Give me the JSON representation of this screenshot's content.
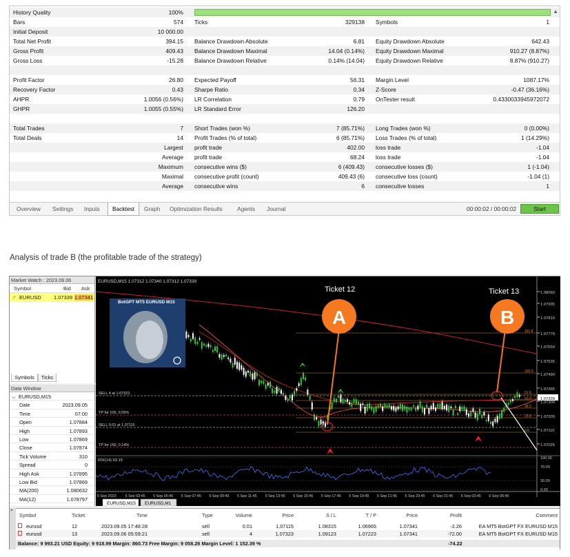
{
  "report": {
    "rows": [
      {
        "cells": [
          "History Quality",
          "100%"
        ]
      },
      {
        "cells": [
          "Bars",
          "574",
          "Ticks",
          "329138",
          "Symbols",
          "1"
        ]
      },
      {
        "cells": [
          "Initial Deposit",
          "10 000.00"
        ]
      },
      {
        "cells": [
          "Total Net Profit",
          "394.15",
          "Balance Drawdown Absolute",
          "6.81",
          "Equity Drawdown Absolute",
          "642.43"
        ]
      },
      {
        "cells": [
          "Gross Profit",
          "409.43",
          "Balance Drawdown Maximal",
          "14.04 (0.14%)",
          "Equity Drawdown Maximal",
          "910.27 (8.87%)"
        ]
      },
      {
        "cells": [
          "Gross Loss",
          "-15.28",
          "Balance Drawdown Relative",
          "0.14% (14.04)",
          "Equity Drawdown Relative",
          "8.87% (910.27)"
        ]
      },
      {
        "cells": []
      },
      {
        "cells": [
          "Profit Factor",
          "26.80",
          "Expected Payoff",
          "56.31",
          "Margin Level",
          "1087.17%"
        ]
      },
      {
        "cells": [
          "Recovery Factor",
          "0.43",
          "Sharpe Ratio",
          "0.34",
          "Z-Score",
          "-0.47 (36.16%)"
        ]
      },
      {
        "cells": [
          "AHPR",
          "1.0056 (0.56%)",
          "LR Correlation",
          "0.79",
          "OnTester result",
          "0.433003394597207​2"
        ]
      },
      {
        "cells": [
          "GHPR",
          "1.0055 (0.55%)",
          "LR Standard Error",
          "126.20"
        ]
      },
      {
        "cells": []
      },
      {
        "cells": [
          "Total Trades",
          "7",
          "Short Trades (won %)",
          "7 (85.71%)",
          "Long Trades (won %)",
          "0 (0.00%)"
        ]
      },
      {
        "cells": [
          "Total Deals",
          "14",
          "Profit Trades (% of total)",
          "6 (85.71%)",
          "Loss Trades (% of total)",
          "1 (14.29%)"
        ]
      },
      {
        "cells": [
          "",
          "Largest",
          "profit trade",
          "402.00",
          "loss trade",
          "-1.04"
        ]
      },
      {
        "cells": [
          "",
          "Average",
          "profit trade",
          "68.24",
          "loss trade",
          "-1.04"
        ]
      },
      {
        "cells": [
          "",
          "Maximum",
          "consecutive wins ($)",
          "6 (409.43)",
          "consecutive losses ($)",
          "1 (-1.04)"
        ]
      },
      {
        "cells": [
          "",
          "Maximal",
          "consecutive profit (count)",
          "409.43 (6)",
          "consecutive loss (count)",
          "-1.04 (1)"
        ]
      },
      {
        "cells": [
          "",
          "Average",
          "consecutive wins",
          "6",
          "consecutive losses",
          "1"
        ]
      }
    ],
    "history_quality_percent": 100,
    "tabs": [
      "Overview",
      "Settings",
      "Inputs",
      "Backtest",
      "Graph",
      "Optimization Results",
      "Agents",
      "Journal"
    ],
    "active_tab": "Backtest",
    "timer": "00:00:02 / 00:00:02",
    "start_label": "Start",
    "bar_color": "#9ce17d",
    "start_color": "#6cc24a"
  },
  "caption": "Analysis of trade B (the profitable trade of the strategy)",
  "market_watch": {
    "title": "Market Watch : 2023.09.06",
    "headers": [
      "Symbol",
      "Bid",
      "Ask"
    ],
    "symbol": "EURUSD",
    "bid": "1.07339",
    "ask": "1.07341",
    "tabs": [
      "Symbols",
      "Ticks"
    ]
  },
  "data_window": {
    "title": "Data Window",
    "symbol": "EURUSD,M15",
    "rows": [
      {
        "label": "Date",
        "value": "2023.09.05"
      },
      {
        "label": "Time",
        "value": "07:00"
      },
      {
        "label": "Open",
        "value": "1.07884"
      },
      {
        "label": "High",
        "value": "1.07893"
      },
      {
        "label": "Low",
        "value": "1.07869"
      },
      {
        "label": "Close",
        "value": "1.07874"
      },
      {
        "label": "Tick Volume",
        "value": "310"
      },
      {
        "label": "Spread",
        "value": "0"
      },
      {
        "label": "High Ask",
        "value": "1.07895"
      },
      {
        "label": "Low Bid",
        "value": "1.07869"
      },
      {
        "label": "MA(200)",
        "value": "1.080632"
      },
      {
        "label": "MA(12)",
        "value": "1.078797"
      }
    ]
  },
  "chart": {
    "header": "EURUSD,M15  1.07312 1.07340 1.07312 1.07339",
    "logo_title": "BotGPT MT5 EURUSD M15",
    "ticket_a_label": "Ticket 12",
    "ticket_b_label": "Ticket 13",
    "marker_a": "A",
    "marker_b": "B",
    "marker_color": "#f47920",
    "line_labels": [
      "SELL 4 at 1.07323",
      "TP for 100, 0.09%",
      "SELL 0.01 at 1.07115",
      "TP for 150, 0.14%"
    ],
    "fib_labels": [
      "161.8",
      "100.0",
      "61.8",
      "50.0",
      "38.2",
      "23.6",
      "0.0"
    ],
    "price_axis": [
      "1.08060",
      "1.07935",
      "1.07810",
      "1.07775",
      "1.07650",
      "1.07535",
      "1.07490",
      "1.07365",
      "1.07339",
      "1.07300",
      "1.07205",
      "1.07110",
      "1.07025"
    ],
    "rsi_label": "RSI(14) 63.15",
    "rsi_axis": [
      "100.00",
      "70.00",
      "30.00",
      "0.00"
    ],
    "time_axis": [
      "5 Sep 2023",
      "5 Sep 03:45",
      "5 Sep 05:45",
      "5 Sep 07:45",
      "5 Sep 09:45",
      "5 Sep 11:45",
      "5 Sep 13:45",
      "5 Sep 15:45",
      "5 Sep 17:45",
      "5 Sep 19:45",
      "5 Sep 21:45",
      "5 Sep 23:45",
      "6 Sep 01:45",
      "6 Sep 03:45",
      "6 Sep 05:45"
    ],
    "tabs": [
      "EURUSD,M15",
      "EURUSD,M1"
    ]
  },
  "toolbox": {
    "headers": [
      "Symbol",
      "Ticket",
      "Time",
      "Type",
      "Volume",
      "Price",
      "S / L",
      "T / P",
      "Price",
      "Profit",
      "Comment"
    ],
    "rows": [
      [
        "eurusd",
        "12",
        "2023.09.05 17:48:28",
        "sell",
        "0.01",
        "1.07115",
        "1.08315",
        "1.06965",
        "1.07341",
        "-2.26",
        "EA MT5 BotGPT FX EURUSD M15"
      ],
      [
        "eurusd",
        "13",
        "2023.09.06 05:59:21",
        "sell",
        "4",
        "1.07323",
        "1.09123",
        "1.07223",
        "1.07341",
        "-72.00",
        "EA MT5 BotGPT FX EURUSD M15"
      ]
    ],
    "balance": "Balance: 9 993.21 USD  Equity: 9 918.99  Margin: 860.73  Free Margin: 9 058.26  Margin Level: 1 152.39 %",
    "total_profit": "-74.22"
  }
}
